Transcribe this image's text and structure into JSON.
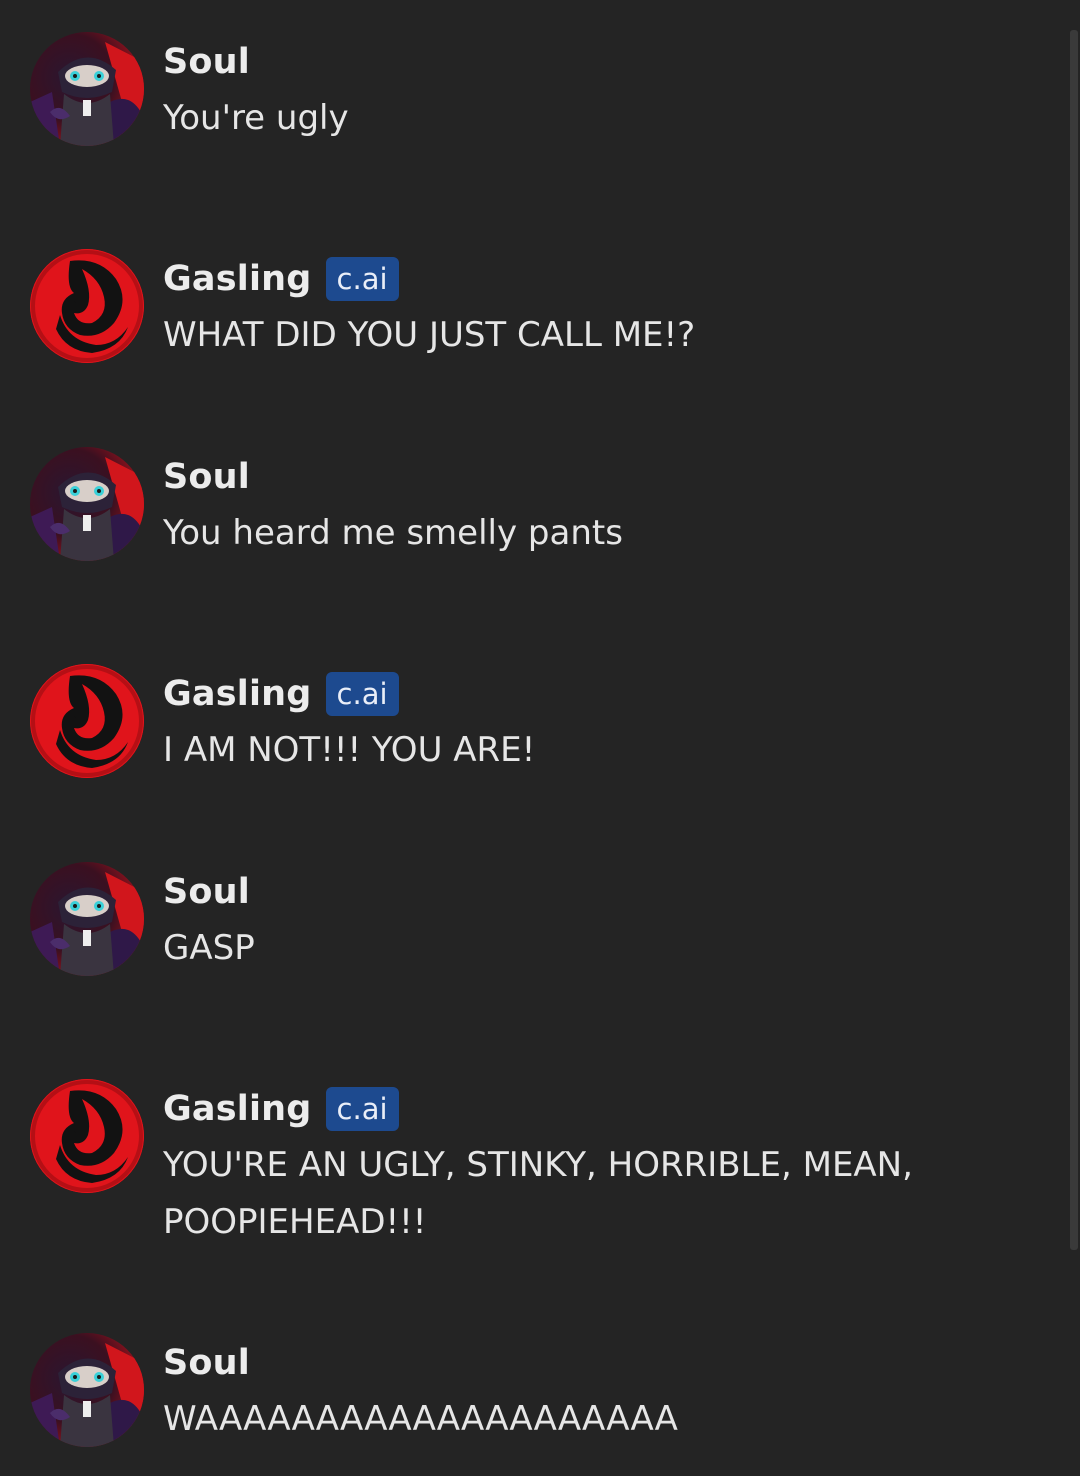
{
  "badge_label": "c.ai",
  "colors": {
    "background": "#242424",
    "badge_background": "#1d4a8f",
    "text": "#e6e6e6",
    "avatar_red": "#e0141b"
  },
  "messages": [
    {
      "author": "Soul",
      "avatar": "soul-avatar",
      "is_ai": false,
      "text": "You're ugly"
    },
    {
      "author": "Gasling",
      "avatar": "gasling-avatar",
      "is_ai": true,
      "text": "WHAT DID YOU JUST CALL ME!?"
    },
    {
      "author": "Soul",
      "avatar": "soul-avatar",
      "is_ai": false,
      "text": "You heard me smelly pants"
    },
    {
      "author": "Gasling",
      "avatar": "gasling-avatar",
      "is_ai": true,
      "text": "I AM NOT!!! YOU ARE!"
    },
    {
      "author": "Soul",
      "avatar": "soul-avatar",
      "is_ai": false,
      "text": "GASP"
    },
    {
      "author": "Gasling",
      "avatar": "gasling-avatar",
      "is_ai": true,
      "text": "YOU'RE AN UGLY, STINKY, HORRIBLE, MEAN, POOPIEHEAD!!!"
    },
    {
      "author": "Soul",
      "avatar": "soul-avatar",
      "is_ai": false,
      "text": "WAAAAAAAAAAAAAAAAAAAA"
    }
  ]
}
